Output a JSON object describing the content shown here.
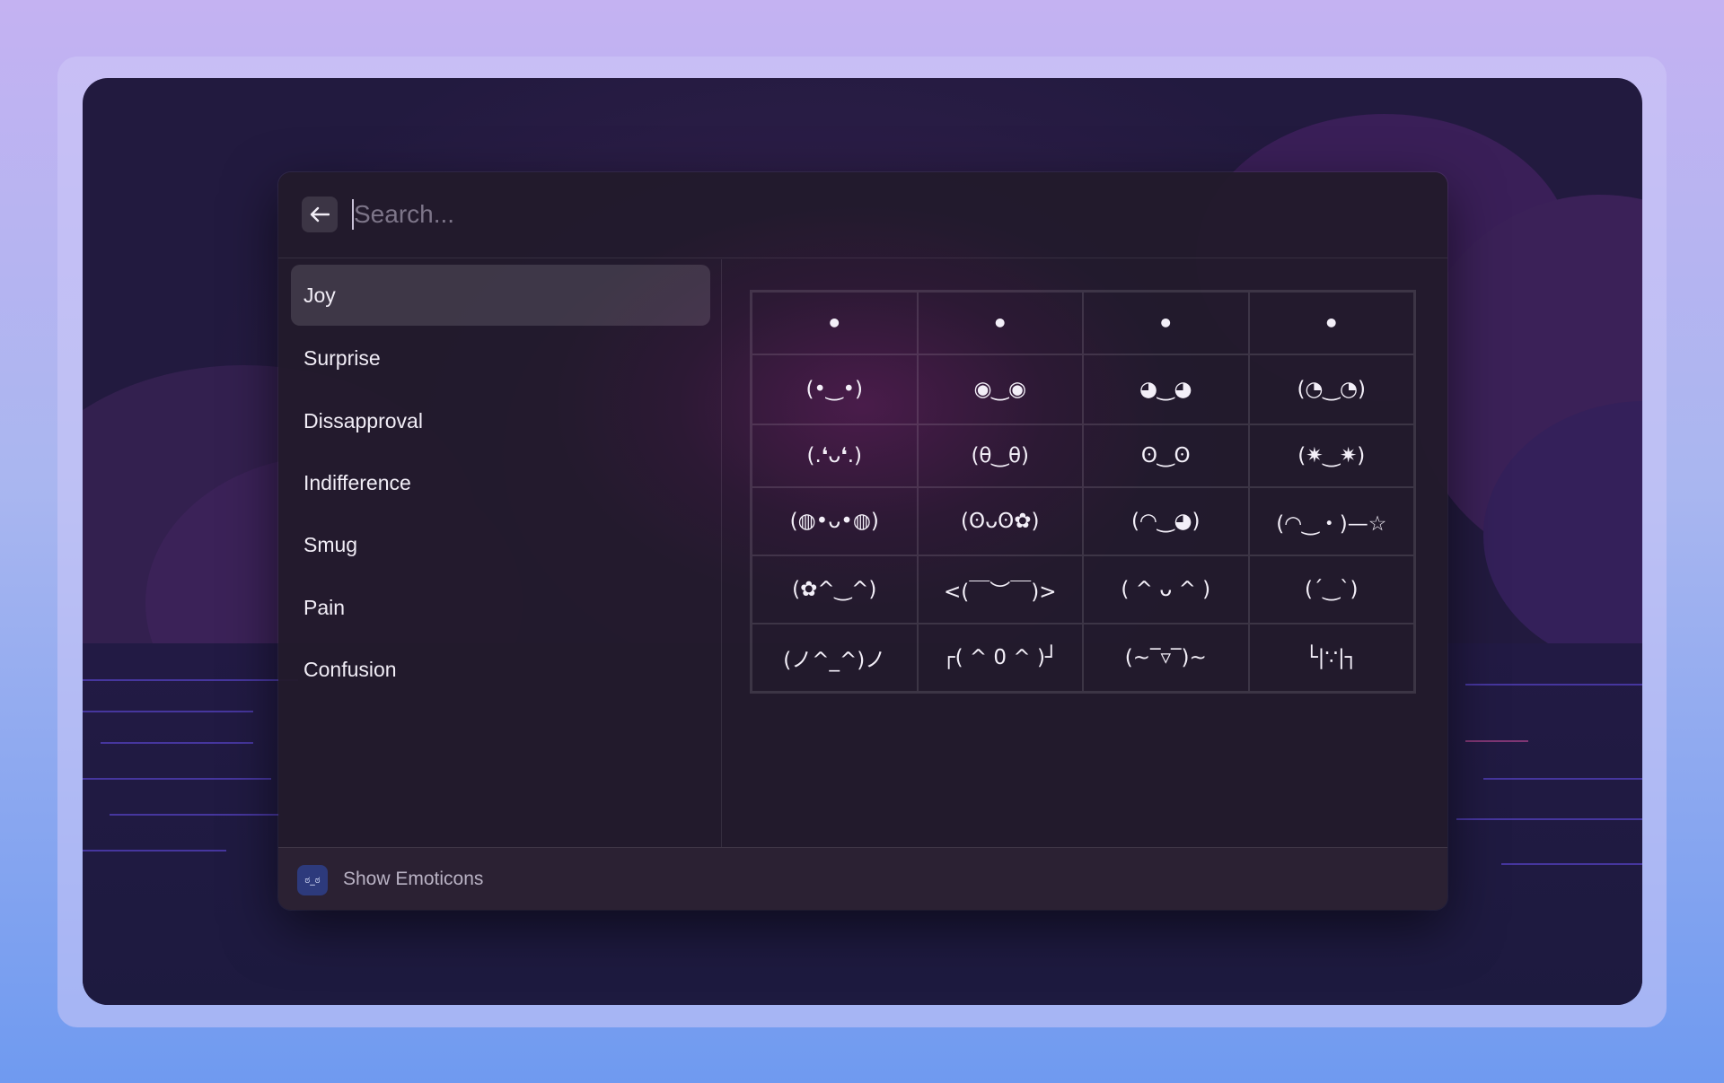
{
  "search": {
    "placeholder": "Search..."
  },
  "sidebar": {
    "items": [
      {
        "label": "Joy",
        "selected": true
      },
      {
        "label": "Surprise"
      },
      {
        "label": "Dissapproval"
      },
      {
        "label": "Indifference"
      },
      {
        "label": "Smug"
      },
      {
        "label": "Pain"
      },
      {
        "label": "Confusion"
      }
    ]
  },
  "grid": {
    "rows": [
      [
        "•",
        "•",
        "•",
        "•"
      ],
      [
        "(•‿•)",
        "◉‿◉",
        "◕‿◕",
        "(◔‿◔)"
      ],
      [
        "(.❛ᴗ❛.)",
        "(θ‿θ)",
        "ʘ‿ʘ",
        "(✷‿✷)"
      ],
      [
        "(◍•ᴗ•◍)",
        "(ʘᴗʘ✿)",
        "(◠‿◕)",
        "(◠‿・)—☆"
      ],
      [
        "(✿^‿^)",
        "<(￣︶￣)>",
        "( ^ ᴗ ^ )",
        "(´‿`)"
      ],
      [
        "(ノ^_^)ノ",
        "┌( ^ 0 ^ )┘",
        "(~‾▿‾)~",
        "└|∵|┐"
      ]
    ]
  },
  "footer": {
    "icon_glyph": "ಠ_ಠ",
    "label": "Show Emoticons"
  },
  "colors": {
    "panel": "#221a2c",
    "accent_selected": "#4a4155",
    "text": "#f1edf6"
  }
}
